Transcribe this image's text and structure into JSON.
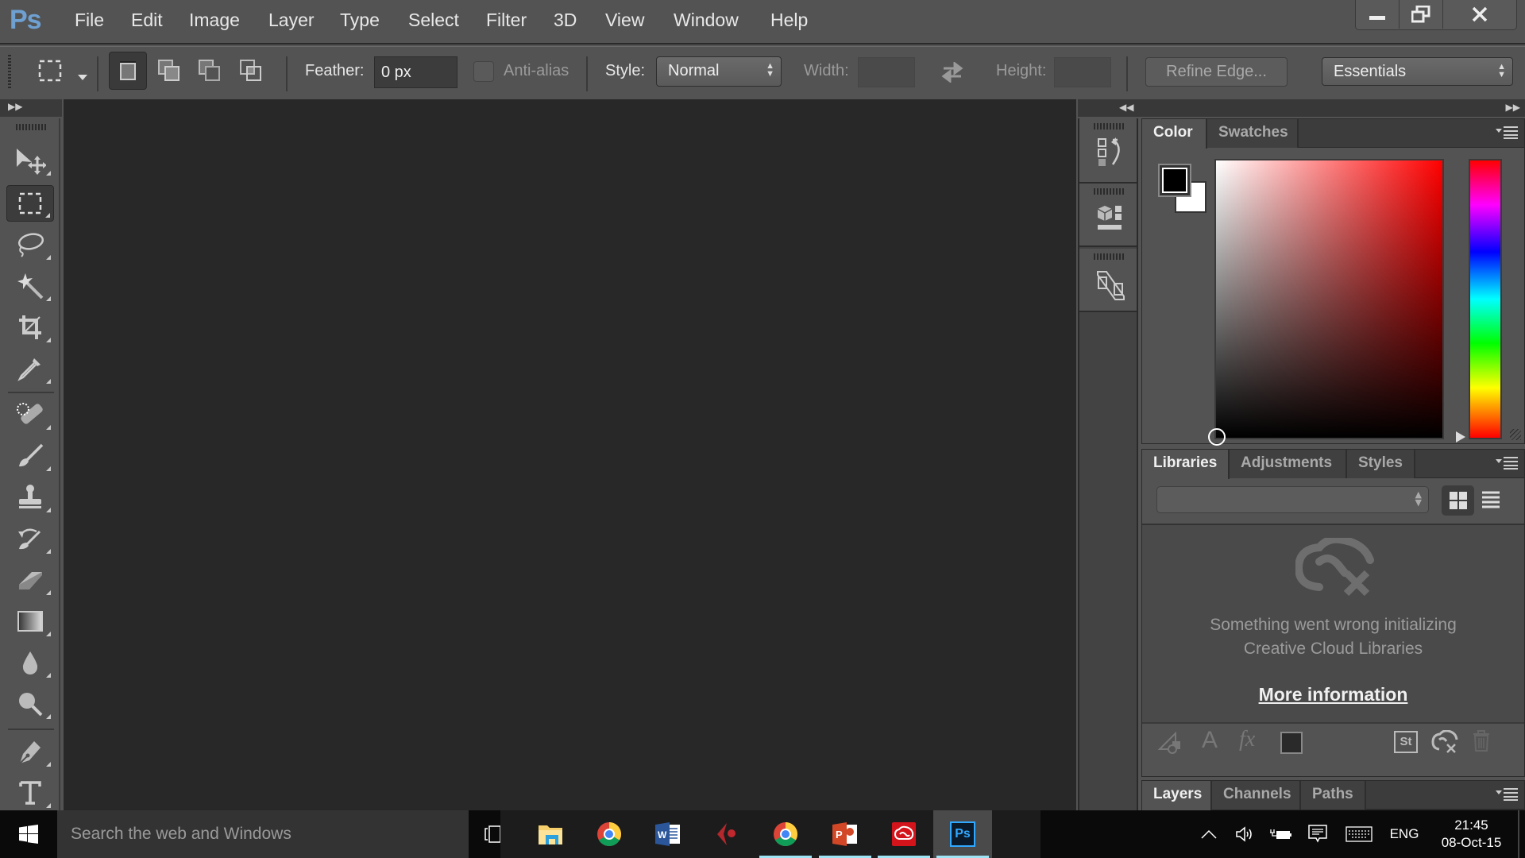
{
  "app": {
    "logo": "Ps",
    "menu": [
      "File",
      "Edit",
      "Image",
      "Layer",
      "Type",
      "Select",
      "Filter",
      "3D",
      "View",
      "Window",
      "Help"
    ],
    "window_controls": [
      "minimize",
      "restore",
      "close"
    ]
  },
  "options_bar": {
    "tool_preset_icon": "rect-marquee-icon",
    "selection_modes": [
      {
        "name": "new-selection",
        "active": true
      },
      {
        "name": "add-to-selection",
        "active": false
      },
      {
        "name": "subtract-from-selection",
        "active": false
      },
      {
        "name": "intersect-with-selection",
        "active": false
      }
    ],
    "feather_label": "Feather:",
    "feather_value": "0 px",
    "antialias_label": "Anti-alias",
    "antialias_checked": false,
    "style_label": "Style:",
    "style_value": "Normal",
    "width_label": "Width:",
    "width_value": "",
    "height_label": "Height:",
    "height_value": "",
    "refine_edge_label": "Refine Edge...",
    "workspace_value": "Essentials"
  },
  "toolbar": {
    "tools": [
      {
        "name": "move-tool",
        "active": false
      },
      {
        "name": "rectangular-marquee-tool",
        "active": true
      },
      {
        "name": "lasso-tool",
        "active": false
      },
      {
        "name": "magic-wand-tool",
        "active": false
      },
      {
        "name": "crop-tool",
        "active": false
      },
      {
        "name": "eyedropper-tool",
        "active": false
      },
      {
        "name": "spot-healing-brush-tool",
        "active": false
      },
      {
        "name": "brush-tool",
        "active": false
      },
      {
        "name": "clone-stamp-tool",
        "active": false
      },
      {
        "name": "history-brush-tool",
        "active": false
      },
      {
        "name": "eraser-tool",
        "active": false
      },
      {
        "name": "gradient-tool",
        "active": false
      },
      {
        "name": "blur-tool",
        "active": false
      },
      {
        "name": "dodge-tool",
        "active": false
      },
      {
        "name": "pen-tool",
        "active": false
      },
      {
        "name": "type-tool",
        "active": false
      }
    ]
  },
  "dock": {
    "items": [
      "history-panel",
      "3d-properties-panel",
      "transform-panel"
    ]
  },
  "color_panel": {
    "tabs": [
      "Color",
      "Swatches"
    ],
    "active_tab": "Color",
    "foreground": "#000000",
    "background": "#ffffff",
    "hue_base": "#ff0000"
  },
  "libraries_panel": {
    "tabs": [
      "Libraries",
      "Adjustments",
      "Styles"
    ],
    "active_tab": "Libraries",
    "library_select_value": "",
    "error_line1": "Something went wrong initializing",
    "error_line2": "Creative Cloud Libraries",
    "more_info_link": "More information",
    "footer_icons": [
      "add-graphic",
      "add-character-style",
      "add-layer-style",
      "add-color",
      "stock",
      "cc-sync",
      "delete"
    ]
  },
  "layers_panel": {
    "tabs": [
      "Layers",
      "Channels",
      "Paths"
    ],
    "active_tab": "Layers"
  },
  "taskbar": {
    "search_placeholder": "Search the web and Windows",
    "apps": [
      {
        "name": "task-view",
        "running": false,
        "active": false
      },
      {
        "name": "file-explorer",
        "running": false,
        "active": false
      },
      {
        "name": "chrome",
        "running": false,
        "active": false
      },
      {
        "name": "word",
        "running": false,
        "active": false
      },
      {
        "name": "cubase",
        "running": false,
        "active": false
      },
      {
        "name": "chrome-2",
        "running": true,
        "active": false
      },
      {
        "name": "powerpoint",
        "running": true,
        "active": false
      },
      {
        "name": "creative-cloud",
        "running": true,
        "active": false
      },
      {
        "name": "photoshop",
        "running": true,
        "active": true
      }
    ],
    "language": "ENG",
    "time": "21:45",
    "date": "08-Oct-15"
  }
}
